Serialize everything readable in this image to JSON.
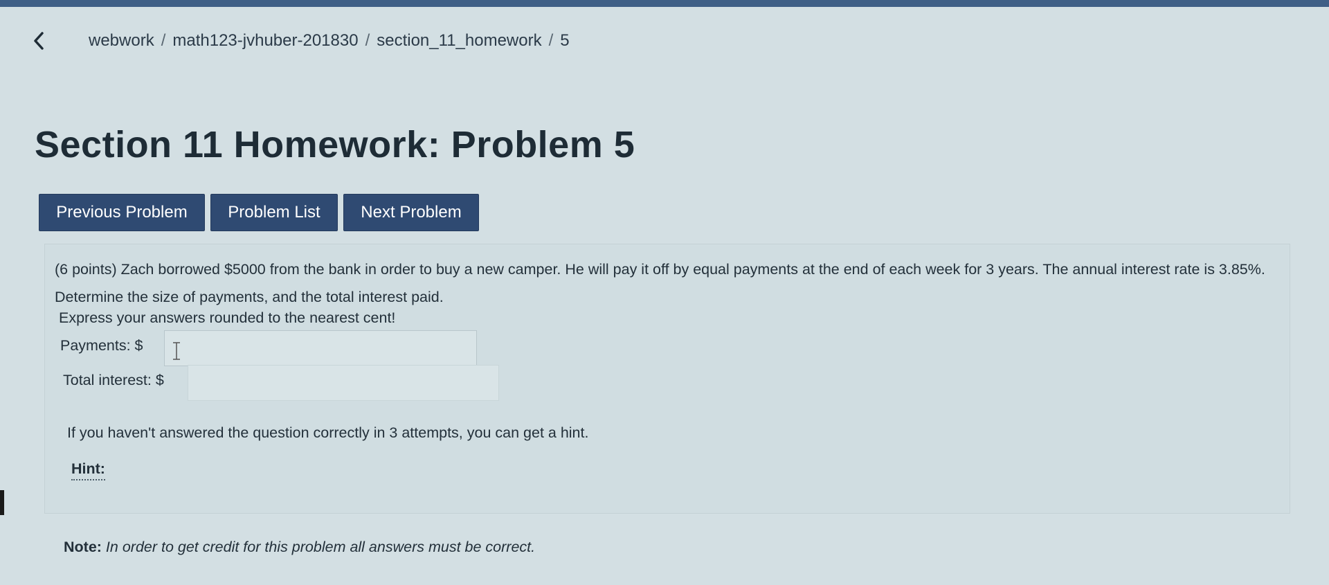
{
  "breadcrumb": {
    "items": [
      "webwork",
      "math123-jvhuber-201830",
      "section_11_homework",
      "5"
    ],
    "separator": "/"
  },
  "page": {
    "title": "Section 11 Homework: Problem 5"
  },
  "nav": {
    "previous_label": "Previous Problem",
    "list_label": "Problem List",
    "next_label": "Next Problem"
  },
  "problem": {
    "statement": "(6 points) Zach borrowed $5000 from the bank in order to buy a new camper. He will pay it off by equal payments at the end of each week for 3 years. The annual interest rate is 3.85%. Determine the size of payments, and the total interest paid.",
    "instructions": "Express your answers rounded to the nearest cent!",
    "payments_label": "Payments: $",
    "payments_value": "",
    "interest_label": "Total interest: $",
    "interest_value": "",
    "hint_message": "If you haven't answered the question correctly in 3 attempts, you can get a hint.",
    "hint_label": "Hint:"
  },
  "note": {
    "label": "Note:",
    "text": "In order to get credit for this problem all answers must be correct."
  },
  "colors": {
    "topbar": "#3f5f86",
    "button_bg": "#2f4a72",
    "page_bg": "#d3dfe3"
  },
  "icons": {
    "back": "chevron-left-icon",
    "text_cursor": "text-cursor-icon"
  }
}
